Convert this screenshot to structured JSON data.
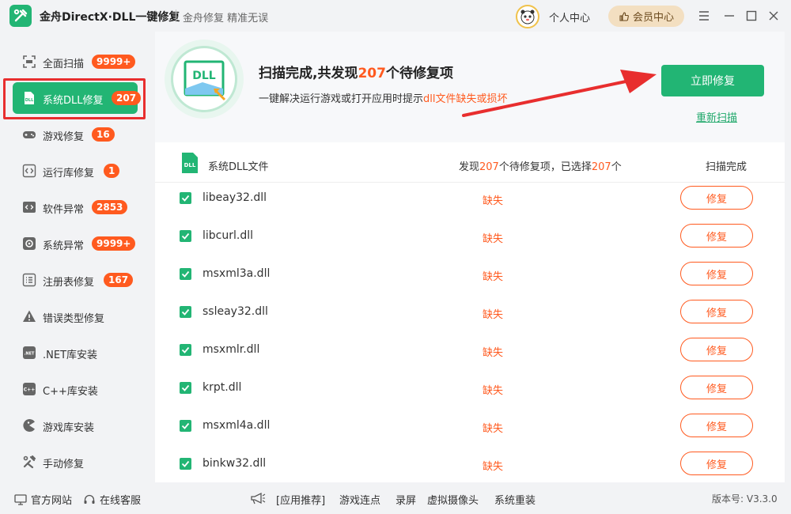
{
  "titlebar": {
    "app_title": "金舟DirectX·DLL一键修复",
    "slogan": "金舟修复 精准无误",
    "user_center": "个人中心",
    "vip": "会员中心"
  },
  "sidebar": {
    "items": [
      {
        "label": "全面扫描",
        "badge": "9999+"
      },
      {
        "label": "系统DLL修复",
        "badge": "207"
      },
      {
        "label": "游戏修复",
        "badge": "16"
      },
      {
        "label": "运行库修复",
        "badge": "1"
      },
      {
        "label": "软件异常",
        "badge": "2853"
      },
      {
        "label": "系统异常",
        "badge": "9999+"
      },
      {
        "label": "注册表修复",
        "badge": "167"
      },
      {
        "label": "错误类型修复",
        "badge": ""
      },
      {
        "label": ".NET库安装",
        "badge": ""
      },
      {
        "label": "C++库安装",
        "badge": ""
      },
      {
        "label": "游戏库安装",
        "badge": ""
      },
      {
        "label": "手动修复",
        "badge": ""
      }
    ]
  },
  "hero": {
    "title_pre": "扫描完成,共发现",
    "title_count": "207",
    "title_post": "个待修复项",
    "sub_pre": "一键解决运行游戏或打开应用时提示",
    "sub_hl": "dll文件缺失或损坏",
    "fix_all": "立即修复",
    "rescan": "重新扫描",
    "icon_text": "DLL"
  },
  "table": {
    "name_header": "系统DLL文件",
    "found_pre": "发现",
    "found_count": "207",
    "found_mid": "个待修复项，已选择",
    "selected_count": "207",
    "found_post": "个",
    "status_header": "扫描完成",
    "icon_text": "DLL",
    "rows": [
      {
        "file": "libeay32.dll",
        "status": "缺失",
        "action": "修复"
      },
      {
        "file": "libcurl.dll",
        "status": "缺失",
        "action": "修复"
      },
      {
        "file": "msxml3a.dll",
        "status": "缺失",
        "action": "修复"
      },
      {
        "file": "ssleay32.dll",
        "status": "缺失",
        "action": "修复"
      },
      {
        "file": "msxmlr.dll",
        "status": "缺失",
        "action": "修复"
      },
      {
        "file": "krpt.dll",
        "status": "缺失",
        "action": "修复"
      },
      {
        "file": "msxml4a.dll",
        "status": "缺失",
        "action": "修复"
      },
      {
        "file": "binkw32.dll",
        "status": "缺失",
        "action": "修复"
      }
    ]
  },
  "footer": {
    "website": "官方网站",
    "service": "在线客服",
    "recommend": "[应用推荐]",
    "links": [
      "游戏连点",
      "录屏",
      "虚拟摄像头",
      "系统重装"
    ],
    "version": "版本号: V3.3.0"
  },
  "colors": {
    "accent": "#22b574",
    "warning": "#ff5a1f",
    "highlight_box": "#e82e2e"
  }
}
